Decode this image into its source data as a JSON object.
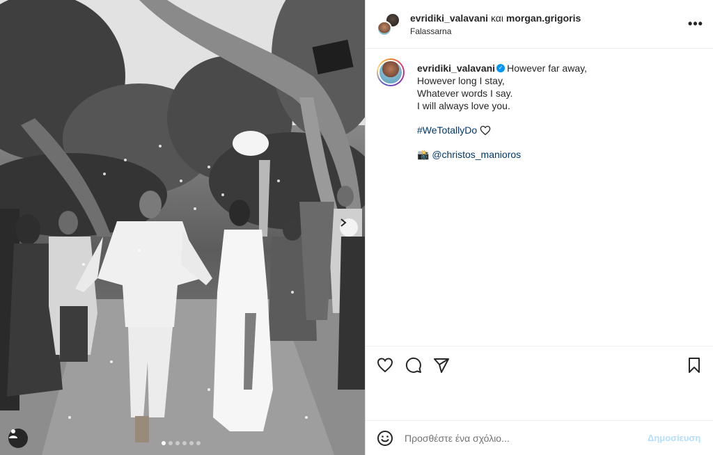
{
  "photo": {
    "dots": [
      true,
      false,
      false,
      false,
      false,
      false
    ],
    "icons": {
      "user_tag": "user-icon",
      "next": "chevron-right-icon"
    }
  },
  "header": {
    "user1": "evridiki_valavani",
    "conjunction": "και",
    "user2": "morgan.grigoris",
    "location": "Falassarna",
    "more": "•••"
  },
  "caption": {
    "username": "evridiki_valavani",
    "lines": [
      "However far away,",
      "However long I stay,",
      "Whatever words I say.",
      "I will always love you."
    ],
    "hashtag": "#WeTotallyDo",
    "camera_emoji": "📸",
    "mention": "@christos_manioros"
  },
  "actions": {
    "icons": [
      "heart-icon",
      "comment-icon",
      "share-icon",
      "bookmark-icon"
    ]
  },
  "comment": {
    "placeholder": "Προσθέστε ένα σχόλιο...",
    "post_label": "Δημοσίευση"
  },
  "colors": {
    "link": "#00376b",
    "verified": "#0095f6",
    "post_disabled": "#b2dffc"
  }
}
